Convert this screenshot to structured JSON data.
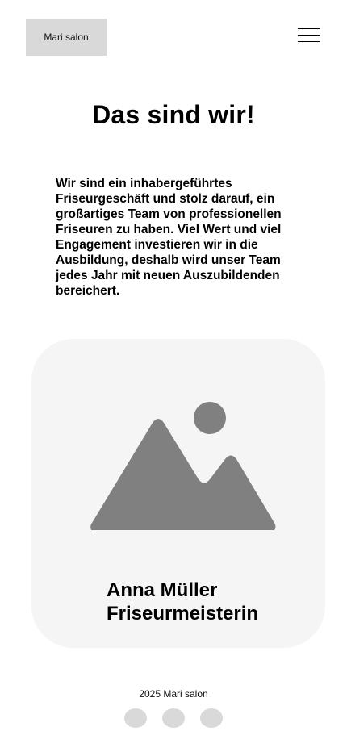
{
  "header": {
    "logo_text": "Mari salon",
    "menu_icon": "hamburger-menu-icon"
  },
  "main": {
    "title": "Das sind wir!",
    "intro": "Wir sind ein inhabergeführtes Friseurgeschäft und stolz darauf, ein großartiges Team von professionellen Friseuren zu haben. Viel Wert und viel Engagement investieren wir in die Ausbildung, deshalb wird unser Team jedes Jahr mit neuen Auszubildenden bereichert."
  },
  "team_card": {
    "image_icon": "image-placeholder-icon",
    "name": "Anna Müller",
    "role": "Friseurmeisterin"
  },
  "footer": {
    "copyright": "2025 Mari salon",
    "social_icons": [
      "social-icon",
      "social-icon",
      "social-icon"
    ]
  },
  "colors": {
    "background": "#ffffff",
    "logo_box": "#d9d9d9",
    "card_background": "#f5f5f5",
    "placeholder_gray": "#808080",
    "social_dot": "#d9d9d9",
    "text": "#000000"
  }
}
